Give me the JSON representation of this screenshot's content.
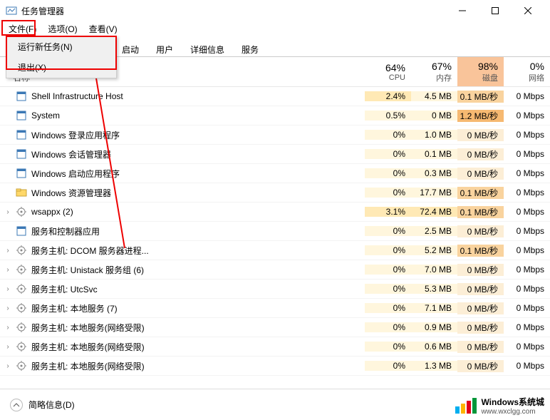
{
  "window": {
    "title": "任务管理器"
  },
  "menu": {
    "file": "文件(F)",
    "options": "选项(O)",
    "view": "查看(V)"
  },
  "file_menu": {
    "run": "运行新任务(N)",
    "exit": "退出(X)"
  },
  "tabs": {
    "startup": "启动",
    "users": "用户",
    "details": "详细信息",
    "services": "服务"
  },
  "columns": {
    "name": "名称",
    "cpu": {
      "pct": "64%",
      "lbl": "CPU"
    },
    "mem": {
      "pct": "67%",
      "lbl": "内存"
    },
    "disk": {
      "pct": "98%",
      "lbl": "磁盘"
    },
    "net": {
      "pct": "0%",
      "lbl": "网络"
    }
  },
  "rows": [
    {
      "exp": "",
      "icon": "app",
      "name": "Shell Infrastructure Host",
      "cpu": "2.4%",
      "cpu_c": "h1",
      "mem": "4.5 MB",
      "mem_c": "",
      "disk": "0.1 MB/秒",
      "disk_c": "h1",
      "net": "0 Mbps"
    },
    {
      "exp": "",
      "icon": "app",
      "name": "System",
      "cpu": "0.5%",
      "cpu_c": "",
      "mem": "0 MB",
      "mem_c": "",
      "disk": "1.2 MB/秒",
      "disk_c": "h2",
      "net": "0 Mbps"
    },
    {
      "exp": "",
      "icon": "app",
      "name": "Windows 登录应用程序",
      "cpu": "0%",
      "cpu_c": "",
      "mem": "1.0 MB",
      "mem_c": "",
      "disk": "0 MB/秒",
      "disk_c": "",
      "net": "0 Mbps"
    },
    {
      "exp": "",
      "icon": "app",
      "name": "Windows 会话管理器",
      "cpu": "0%",
      "cpu_c": "",
      "mem": "0.1 MB",
      "mem_c": "",
      "disk": "0 MB/秒",
      "disk_c": "",
      "net": "0 Mbps"
    },
    {
      "exp": "",
      "icon": "app",
      "name": "Windows 启动应用程序",
      "cpu": "0%",
      "cpu_c": "",
      "mem": "0.3 MB",
      "mem_c": "",
      "disk": "0 MB/秒",
      "disk_c": "",
      "net": "0 Mbps"
    },
    {
      "exp": "",
      "icon": "explorer",
      "name": "Windows 资源管理器",
      "cpu": "0%",
      "cpu_c": "",
      "mem": "17.7 MB",
      "mem_c": "",
      "disk": "0.1 MB/秒",
      "disk_c": "h1",
      "net": "0 Mbps"
    },
    {
      "exp": "›",
      "icon": "gear",
      "name": "wsappx (2)",
      "cpu": "3.1%",
      "cpu_c": "h1",
      "mem": "72.4 MB",
      "mem_c": "h1",
      "disk": "0.1 MB/秒",
      "disk_c": "h1",
      "net": "0 Mbps"
    },
    {
      "exp": "",
      "icon": "app",
      "name": "服务和控制器应用",
      "cpu": "0%",
      "cpu_c": "",
      "mem": "2.5 MB",
      "mem_c": "",
      "disk": "0 MB/秒",
      "disk_c": "",
      "net": "0 Mbps"
    },
    {
      "exp": "›",
      "icon": "gear",
      "name": "服务主机: DCOM 服务器进程...",
      "cpu": "0%",
      "cpu_c": "",
      "mem": "5.2 MB",
      "mem_c": "",
      "disk": "0.1 MB/秒",
      "disk_c": "h1",
      "net": "0 Mbps"
    },
    {
      "exp": "›",
      "icon": "gear",
      "name": "服务主机: Unistack 服务组 (6)",
      "cpu": "0%",
      "cpu_c": "",
      "mem": "7.0 MB",
      "mem_c": "",
      "disk": "0 MB/秒",
      "disk_c": "",
      "net": "0 Mbps"
    },
    {
      "exp": "›",
      "icon": "gear",
      "name": "服务主机: UtcSvc",
      "cpu": "0%",
      "cpu_c": "",
      "mem": "5.3 MB",
      "mem_c": "",
      "disk": "0 MB/秒",
      "disk_c": "",
      "net": "0 Mbps"
    },
    {
      "exp": "›",
      "icon": "gear",
      "name": "服务主机: 本地服务 (7)",
      "cpu": "0%",
      "cpu_c": "",
      "mem": "7.1 MB",
      "mem_c": "",
      "disk": "0 MB/秒",
      "disk_c": "",
      "net": "0 Mbps"
    },
    {
      "exp": "›",
      "icon": "gear",
      "name": "服务主机: 本地服务(网络受限)",
      "cpu": "0%",
      "cpu_c": "",
      "mem": "0.9 MB",
      "mem_c": "",
      "disk": "0 MB/秒",
      "disk_c": "",
      "net": "0 Mbps"
    },
    {
      "exp": "›",
      "icon": "gear",
      "name": "服务主机: 本地服务(网络受限)",
      "cpu": "0%",
      "cpu_c": "",
      "mem": "0.6 MB",
      "mem_c": "",
      "disk": "0 MB/秒",
      "disk_c": "",
      "net": "0 Mbps"
    },
    {
      "exp": "›",
      "icon": "gear",
      "name": "服务主机: 本地服务(网络受限)",
      "cpu": "0%",
      "cpu_c": "",
      "mem": "1.3 MB",
      "mem_c": "",
      "disk": "0 MB/秒",
      "disk_c": "",
      "net": "0 Mbps"
    }
  ],
  "footer": {
    "less": "简略信息(D)"
  },
  "watermark": {
    "brand": "Windows系统城",
    "url": "www.wxclgg.com"
  }
}
